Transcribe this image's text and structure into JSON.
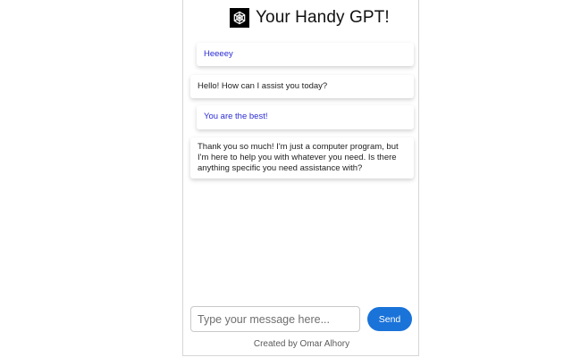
{
  "header": {
    "title": "Your Handy GPT!",
    "logo_icon": "openai-logo-icon"
  },
  "messages": [
    {
      "role": "user",
      "text": "Heeeey"
    },
    {
      "role": "bot",
      "text": "Hello! How can I assist you today?"
    },
    {
      "role": "user",
      "text": "You are the best!"
    },
    {
      "role": "bot",
      "text": "Thank you so much! I'm just a computer program, but I'm here to help you with whatever you need. Is there anything specific you need assistance with?"
    }
  ],
  "composer": {
    "placeholder": "Type your message here...",
    "value": "",
    "send_label": "Send"
  },
  "footer": {
    "credit": "Created by Omar Alhory"
  },
  "colors": {
    "user_text": "#2b2bd6",
    "bot_text": "#222222",
    "send_button": "#1a73d9"
  }
}
